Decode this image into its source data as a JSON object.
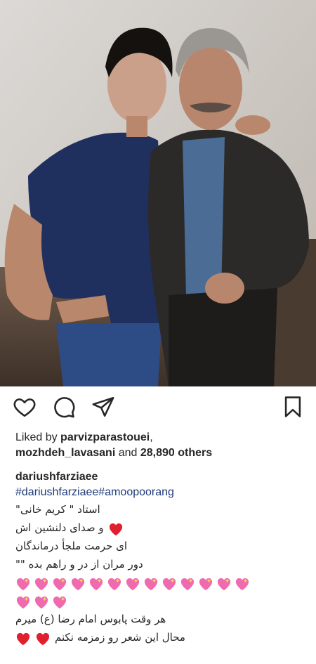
{
  "post": {
    "liked_by_prefix": "Liked by ",
    "liker1": "parvizparastouei",
    "liker2": "mozhdeh_lavasani",
    "and_text": " and ",
    "others": "28,890 others",
    "username": "dariushfarziaee",
    "hashtags": "#dariushfarziaee#amoopoorang",
    "caption_lines": [
      "استاد \" کریم خانی\"",
      "و صدای دلنشین اش",
      "ای حرمت  ملجأ درماندگان",
      "دور مران  از در و راهم بده \"\"",
      "هر وقت پابوس امام رضا (ع) میرم",
      "محال این شعر رو زمزمه نکنم"
    ]
  },
  "icons": {
    "like": "heart-outline-icon",
    "comment": "comment-bubble-icon",
    "share": "paper-plane-icon",
    "save": "bookmark-icon",
    "emoji_heart": "red-heart-emoji",
    "emoji_sparkle": "sparkling-heart-emoji"
  },
  "colors": {
    "text": "#262626",
    "hashtag": "#1f3b7a",
    "red_heart": "#e0202e",
    "sparkle_heart": "#f06ab0"
  }
}
